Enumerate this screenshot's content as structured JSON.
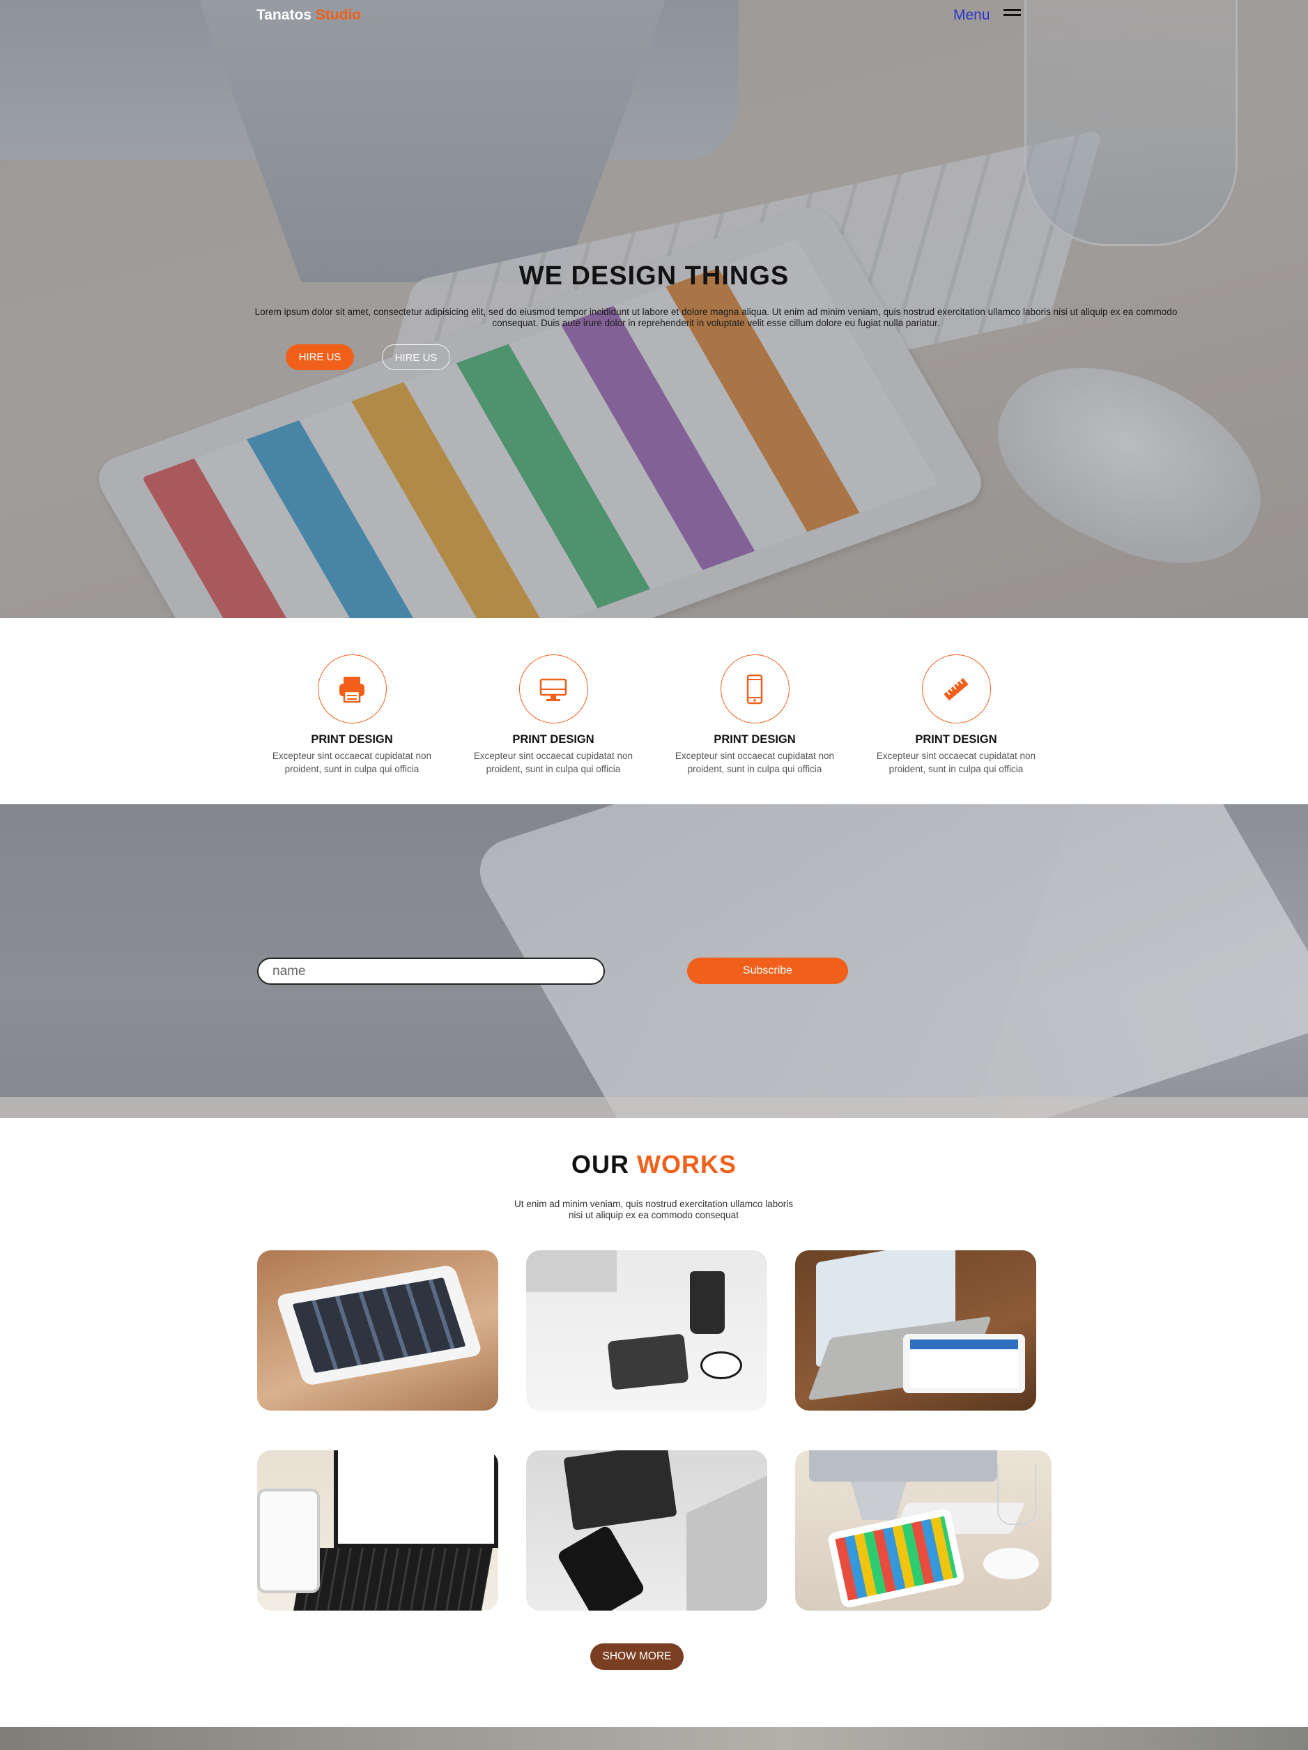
{
  "nav": {
    "brand_main": "Tanatos",
    "brand_accent": "Studio",
    "menu_label": "Menu",
    "menu_icon": "hamburger-icon"
  },
  "hero": {
    "title": "WE DESIGN THINGS",
    "text": "Lorem ipsum dolor sit amet, consectetur adipisicing elit, sed do eiusmod tempor incididunt ut labore et dolore magna aliqua. Ut enim ad minim veniam, quis nostrud exercitation ullamco laboris nisi ut aliquip ex ea commodo consequat. Duis aute irure dolor in reprehenderit in voluptate velit esse cillum dolore eu fugiat nulla pariatur.",
    "button_primary": "HIRE US",
    "button_secondary": "HIRE US"
  },
  "services": [
    {
      "icon": "printer-icon",
      "title": "PRINT DESIGN",
      "desc": "Excepteur sint occaecat cupidatat non proident, sunt in culpa qui officia"
    },
    {
      "icon": "monitor-icon",
      "title": "PRINT DESIGN",
      "desc": "Excepteur sint occaecat cupidatat non proident, sunt in culpa qui officia"
    },
    {
      "icon": "mobile-phone-icon",
      "title": "PRINT DESIGN",
      "desc": "Excepteur sint occaecat cupidatat non proident, sunt in culpa qui officia"
    },
    {
      "icon": "ruler-pencil-icon",
      "title": "PRINT DESIGN",
      "desc": "Excepteur sint occaecat cupidatat non proident, sunt in culpa qui officia"
    }
  ],
  "subscribe": {
    "placeholder": "name",
    "button": "Subscribe"
  },
  "works": {
    "title_main": "OUR",
    "title_accent": "WORKS",
    "text": "Ut enim ad minim veniam, quis nostrud exercitation ullamco laboris nisi ut aliquip ex ea commodo consequat",
    "items": [
      "tablet-on-desk",
      "desk-with-coffee",
      "laptop-and-tablet",
      "laptop-with-charts",
      "notebook-and-phone",
      "imac-and-ipad"
    ],
    "show_more": "SHOW MORE"
  },
  "colors": {
    "accent": "#f0601a",
    "show_more_bg": "#7a3f22",
    "menu_text": "#2a35c9"
  }
}
